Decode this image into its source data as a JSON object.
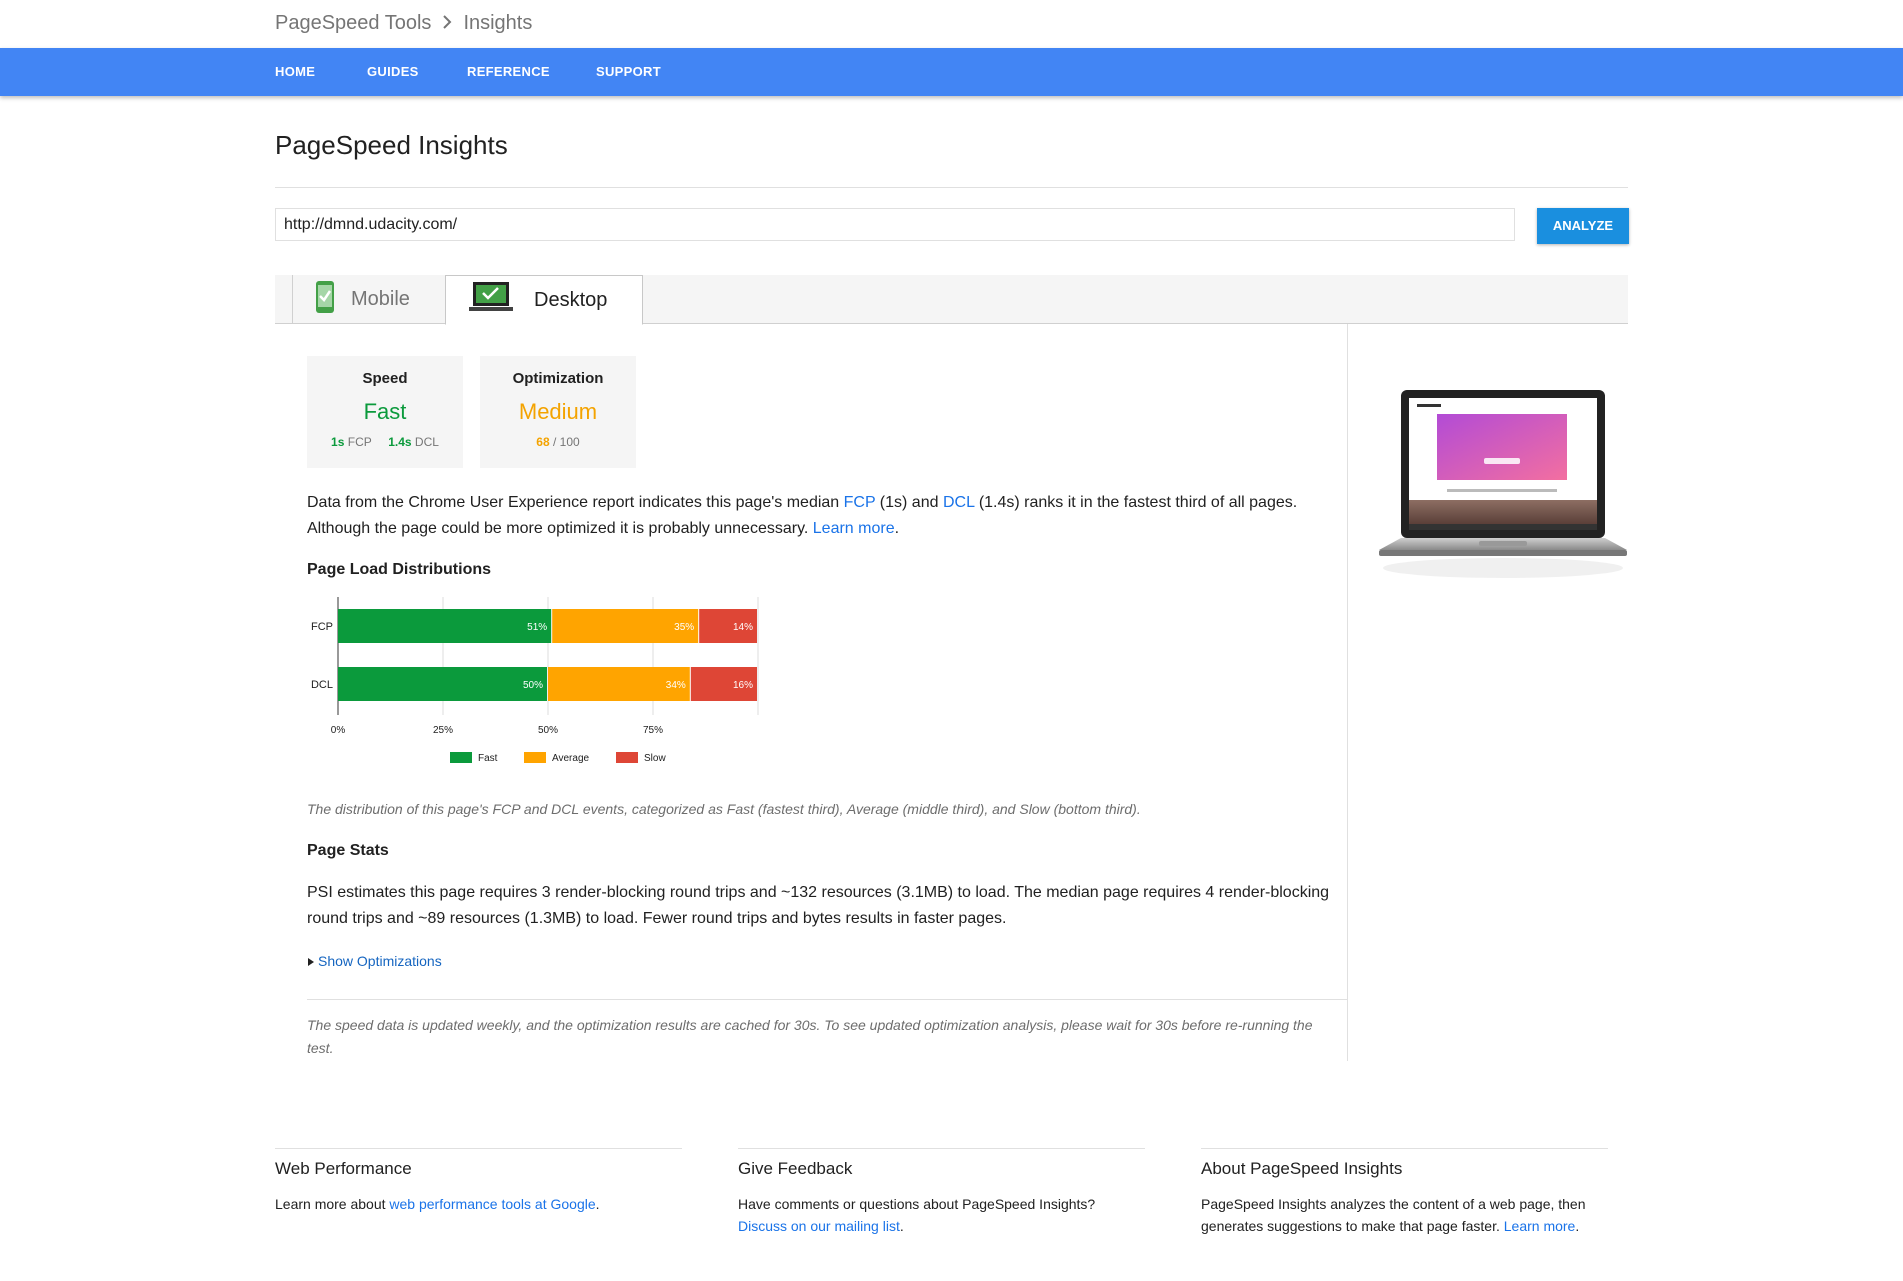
{
  "breadcrumb": {
    "root": "PageSpeed Tools",
    "current": "Insights"
  },
  "nav": {
    "items": [
      "HOME",
      "GUIDES",
      "REFERENCE",
      "SUPPORT"
    ]
  },
  "page_title": "PageSpeed Insights",
  "url_input": {
    "value": "http://dmnd.udacity.com/"
  },
  "analyze_label": "ANALYZE",
  "tabs": {
    "mobile": "Mobile",
    "desktop": "Desktop"
  },
  "speed": {
    "label": "Speed",
    "value": "Fast",
    "fcp_value": "1s",
    "fcp_label": "FCP",
    "dcl_value": "1.4s",
    "dcl_label": "DCL"
  },
  "optimization": {
    "label": "Optimization",
    "value": "Medium",
    "score": "68",
    "max": "/ 100"
  },
  "summary": {
    "part1": "Data from the Chrome User Experience report indicates this page's median ",
    "fcp_link": "FCP",
    "part2": " (1s) and ",
    "dcl_link": "DCL",
    "part3": " (1.4s) ranks it in the fastest third of all pages. Although the page could be more optimized it is probably unnecessary. ",
    "learn_more": "Learn more",
    "part4": "."
  },
  "distributions_heading": "Page Load Distributions",
  "chart_data": {
    "type": "bar",
    "stacked": true,
    "orientation": "horizontal",
    "categories": [
      "FCP",
      "DCL"
    ],
    "series": [
      {
        "name": "Fast",
        "values": [
          51,
          50
        ],
        "color": "#0b9a3c"
      },
      {
        "name": "Average",
        "values": [
          35,
          34
        ],
        "color": "#ffa400"
      },
      {
        "name": "Slow",
        "values": [
          14,
          16
        ],
        "color": "#de4636"
      }
    ],
    "x_ticks": [
      "0%",
      "25%",
      "50%",
      "75%"
    ],
    "xlim": [
      0,
      100
    ],
    "legend_position": "bottom",
    "grid": true
  },
  "distribution_caption": "The distribution of this page's FCP and DCL events, categorized as Fast (fastest third), Average (middle third), and Slow (bottom third).",
  "page_stats_heading": "Page Stats",
  "page_stats_text": "PSI estimates this page requires 3 render-blocking round trips and ~132 resources (3.1MB) to load. The median page requires 4 render-blocking round trips and ~89 resources (1.3MB) to load. Fewer round trips and bytes results in faster pages.",
  "show_optimizations": "Show Optimizations",
  "cache_note": "The speed data is updated weekly, and the optimization results are cached for 30s. To see updated optimization analysis, please wait for 30s before re-running the test.",
  "footer": {
    "web_performance": {
      "title": "Web Performance",
      "text": "Learn more about ",
      "link": "web performance tools at Google",
      "end": "."
    },
    "feedback": {
      "title": "Give Feedback",
      "text": "Have comments or questions about PageSpeed Insights? ",
      "link": "Discuss on our mailing list",
      "end": "."
    },
    "about": {
      "title": "About PageSpeed Insights",
      "text": "PageSpeed Insights analyzes the content of a web page, then generates suggestions to make that page faster. ",
      "link": "Learn more",
      "end": "."
    }
  },
  "colors": {
    "nav": "#4285f4",
    "fast": "#0b9a3c",
    "average": "#ffa400",
    "slow": "#de4636",
    "link": "#1a73e8",
    "button": "#1a8fdf"
  }
}
